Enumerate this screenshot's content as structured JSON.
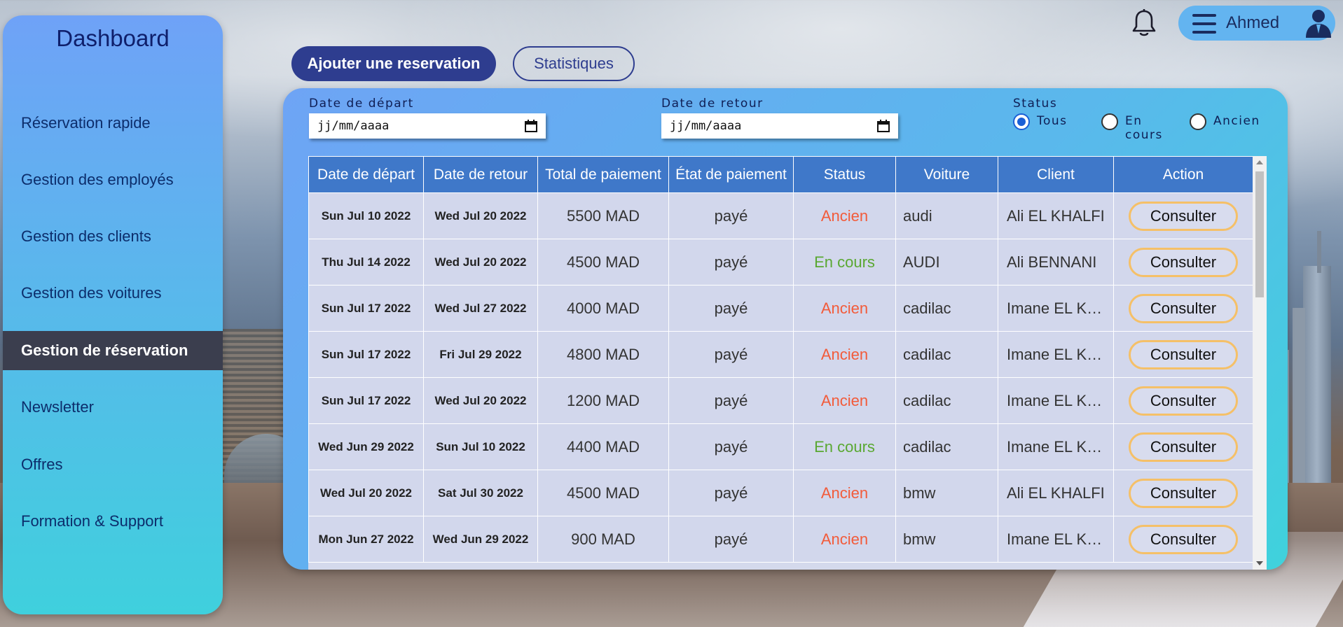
{
  "sidebar": {
    "title": "Dashboard",
    "items": [
      {
        "label": "Réservation rapide"
      },
      {
        "label": "Gestion des employés"
      },
      {
        "label": "Gestion des clients"
      },
      {
        "label": "Gestion des voitures"
      },
      {
        "label": "Gestion de réservation",
        "active": true
      },
      {
        "label": "Newsletter"
      },
      {
        "label": "Offres"
      },
      {
        "label": "Formation & Support"
      }
    ]
  },
  "header": {
    "user_name": "Ahmed",
    "icons": [
      "bell-icon",
      "menu-icon",
      "user-icon"
    ]
  },
  "actions": {
    "add_label": "Ajouter une reservation",
    "stats_label": "Statistiques"
  },
  "filters": {
    "depart_label": "Date de départ",
    "depart_placeholder": "jj/mm/aaaa",
    "retour_label": "Date de retour",
    "retour_placeholder": "jj/mm/aaaa",
    "status_label": "Status",
    "options": [
      {
        "label": "Tous",
        "checked": true
      },
      {
        "label": "En cours",
        "checked": false
      },
      {
        "label": "Ancien",
        "checked": false
      }
    ]
  },
  "table": {
    "columns": [
      "Date de départ",
      "Date de retour",
      "Total de paiement",
      "État de paiement",
      "Status",
      "Voiture",
      "Client",
      "Action"
    ],
    "action_label": "Consulter",
    "rows": [
      {
        "depart": "Sun Jul 10 2022",
        "retour": "Wed Jul 20 2022",
        "total": "5500 MAD",
        "etat": "payé",
        "status": "Ancien",
        "voiture": "audi",
        "client": "Ali EL KHALFI"
      },
      {
        "depart": "Thu Jul 14 2022",
        "retour": "Wed Jul 20 2022",
        "total": "4500 MAD",
        "etat": "payé",
        "status": "En cours",
        "voiture": "AUDI",
        "client": "Ali BENNANI"
      },
      {
        "depart": "Sun Jul 17 2022",
        "retour": "Wed Jul 27 2022",
        "total": "4000 MAD",
        "etat": "payé",
        "status": "Ancien",
        "voiture": "cadilac",
        "client": "Imane EL KHALFI"
      },
      {
        "depart": "Sun Jul 17 2022",
        "retour": "Fri Jul 29 2022",
        "total": "4800 MAD",
        "etat": "payé",
        "status": "Ancien",
        "voiture": "cadilac",
        "client": "Imane EL KHALFI"
      },
      {
        "depart": "Sun Jul 17 2022",
        "retour": "Wed Jul 20 2022",
        "total": "1200 MAD",
        "etat": "payé",
        "status": "Ancien",
        "voiture": "cadilac",
        "client": "Imane EL KHALFI"
      },
      {
        "depart": "Wed Jun 29 2022",
        "retour": "Sun Jul 10 2022",
        "total": "4400 MAD",
        "etat": "payé",
        "status": "En cours",
        "voiture": "cadilac",
        "client": "Imane EL KHALFI"
      },
      {
        "depart": "Wed Jul 20 2022",
        "retour": "Sat Jul 30 2022",
        "total": "4500 MAD",
        "etat": "payé",
        "status": "Ancien",
        "voiture": "bmw",
        "client": "Ali EL KHALFI"
      },
      {
        "depart": "Mon Jun 27 2022",
        "retour": "Wed Jun 29 2022",
        "total": "900 MAD",
        "etat": "payé",
        "status": "Ancien",
        "voiture": "bmw",
        "client": "Imane EL KHALFI"
      }
    ]
  },
  "colors": {
    "primary": "#2e3d8f",
    "header_blue": "#3f78c9",
    "ancien": "#f25b3a",
    "en_cours": "#5aa832",
    "consult_border": "#f5c068",
    "active_nav": "#3b3e4e"
  }
}
